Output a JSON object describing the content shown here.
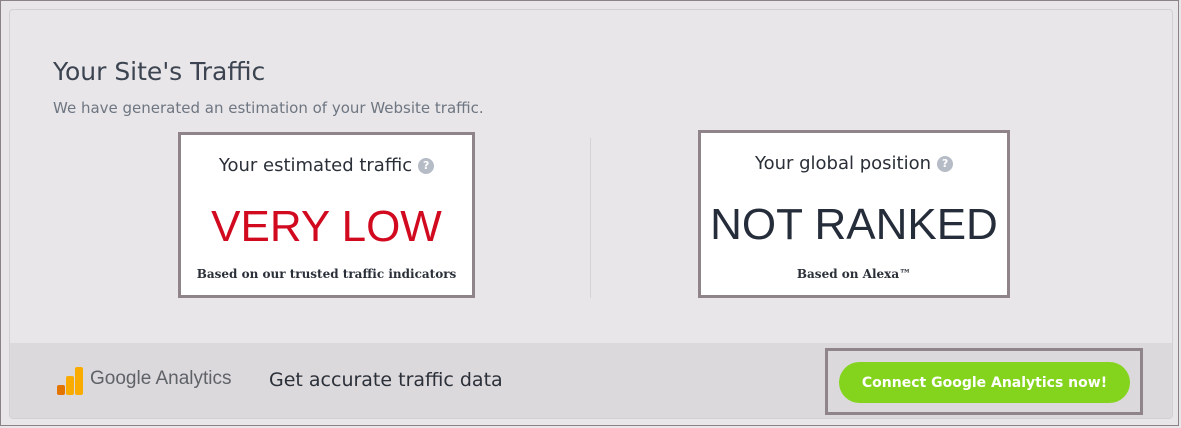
{
  "header": {
    "title": "Your Site's Traffic",
    "subtitle": "We have generated an estimation of your Website traffic."
  },
  "metrics": [
    {
      "label": "Your estimated traffic",
      "value": "VERY LOW",
      "note": "Based on our trusted traffic indicators",
      "help_icon": "?",
      "value_color": "#d10a1f"
    },
    {
      "label": "Your global position",
      "value": "NOT RANKED",
      "note": "Based on Alexa™",
      "help_icon": "?",
      "value_color": "#262d3a"
    }
  ],
  "footer": {
    "brand": "Google Analytics",
    "tagline": "Get accurate traffic data",
    "button_label": "Connect Google Analytics now!",
    "button_color": "#84d41e"
  }
}
